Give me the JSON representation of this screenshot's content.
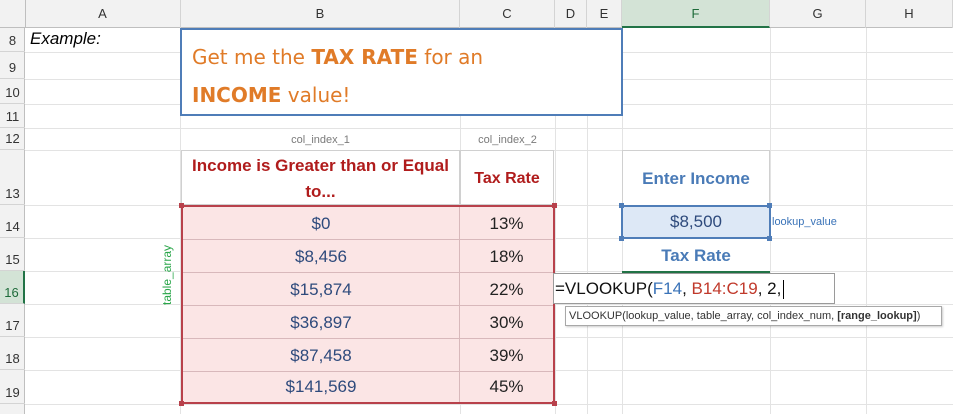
{
  "columns": [
    "A",
    "B",
    "C",
    "D",
    "E",
    "F",
    "G",
    "H"
  ],
  "rows": [
    "8",
    "9",
    "10",
    "11",
    "12",
    "13",
    "14",
    "15",
    "16",
    "17",
    "18",
    "19"
  ],
  "selected_column": "F",
  "selected_row": "16",
  "example_label": "Example:",
  "callout": {
    "line1_pre": "Get me the ",
    "line1_bold": "TAX RATE",
    "line1_post": " for an",
    "line2_bold": "INCOME",
    "line2_post": " value!"
  },
  "col_index_1": "col_index_1",
  "col_index_2": "col_index_2",
  "table": {
    "header_income": "Income is Greater than or Equal to...",
    "header_rate": "Tax Rate",
    "rows": [
      {
        "income": "$0",
        "rate": "13%"
      },
      {
        "income": "$8,456",
        "rate": "18%"
      },
      {
        "income": "$15,874",
        "rate": "22%"
      },
      {
        "income": "$36,897",
        "rate": "30%"
      },
      {
        "income": "$87,458",
        "rate": "39%"
      },
      {
        "income": "$141,569",
        "rate": "45%"
      }
    ]
  },
  "table_array_label": "table_array",
  "enter_income_label": "Enter Income",
  "income_value": "$8,500",
  "lookup_value_label": "lookup_value",
  "tax_rate_label": "Tax Rate",
  "formula": {
    "prefix": "=VLOOKUP(",
    "ref1": "F14",
    "sep1": ", ",
    "ref2": "B14:C19",
    "suffix": ", 2,"
  },
  "tooltip": {
    "text": "VLOOKUP(lookup_value, table_array, col_index_num, ",
    "bold": "[range_lookup]",
    "close": ")"
  },
  "colors": {
    "callout_text": "#e07b28",
    "table_header": "#b01c1c",
    "table_fill": "#fbe5e5",
    "accent_blue": "#4f7db8",
    "excel_green": "#217346"
  }
}
